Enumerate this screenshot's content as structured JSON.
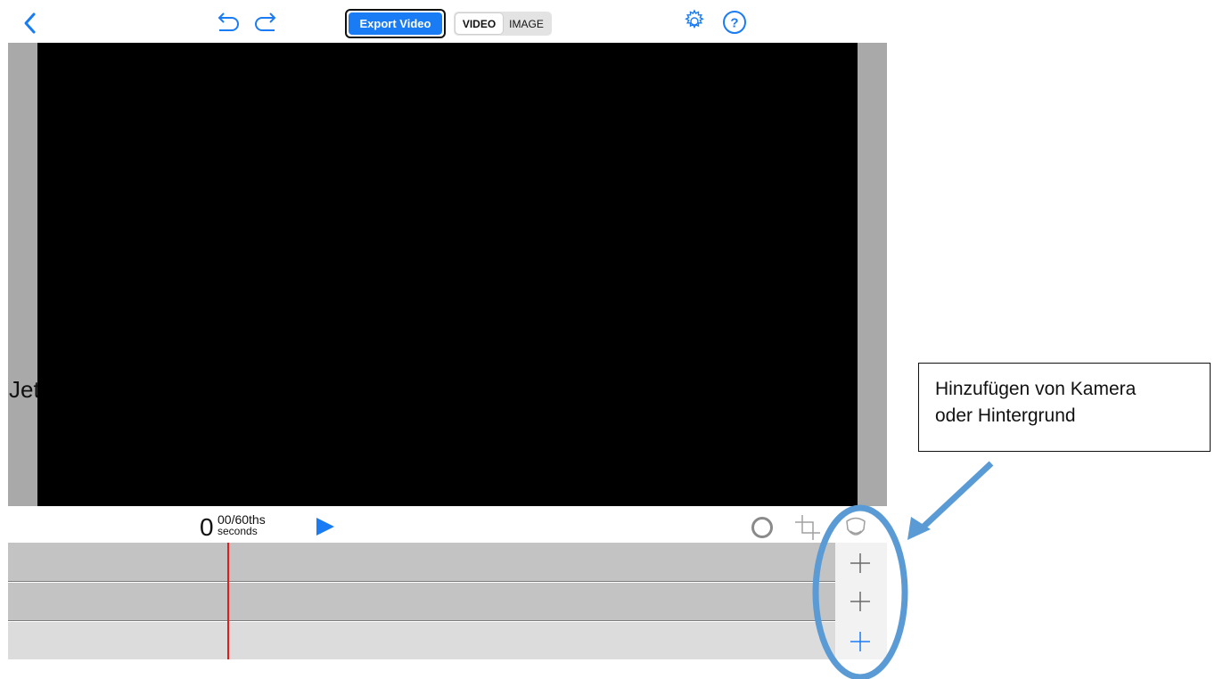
{
  "toolbar": {
    "export_label": "Export Video",
    "mode_options": [
      "VIDEO",
      "IMAGE"
    ],
    "mode_selected": "VIDEO"
  },
  "canvas": {
    "partial_text": "Jet"
  },
  "time": {
    "value": "0",
    "fraction": "00/60ths",
    "unit": "seconds"
  },
  "annotation": {
    "line1": "Hinzufügen von Kamera",
    "line2": "oder Hintergrund"
  },
  "colors": {
    "accent": "#1a7cf4",
    "playhead": "#e21b1b",
    "annotation": "#5b9bd5"
  }
}
